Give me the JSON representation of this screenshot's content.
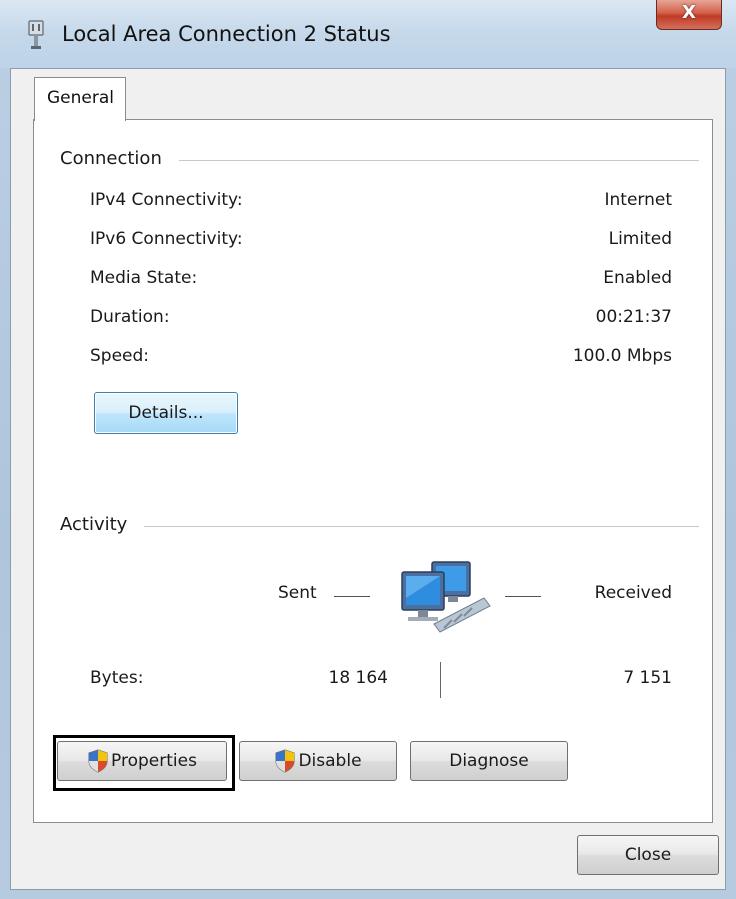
{
  "window": {
    "title": "Local Area Connection 2 Status",
    "close_glyph": "X",
    "title_icon": "network-adapter-icon"
  },
  "tabs": [
    {
      "label": "General"
    }
  ],
  "connection": {
    "heading": "Connection",
    "rows": [
      {
        "label": "IPv4 Connectivity:",
        "value": "Internet"
      },
      {
        "label": "IPv6 Connectivity:",
        "value": "Limited"
      },
      {
        "label": "Media State:",
        "value": "Enabled"
      },
      {
        "label": "Duration:",
        "value": "00:21:37"
      },
      {
        "label": "Speed:",
        "value": "100.0 Mbps"
      }
    ],
    "details_button": "Details..."
  },
  "activity": {
    "heading": "Activity",
    "sent_label": "Sent",
    "received_label": "Received",
    "bytes_label": "Bytes:",
    "bytes_sent": "18 164",
    "bytes_received": "7 151",
    "icon": "network-computers-icon"
  },
  "buttons": {
    "properties": "Properties",
    "disable": "Disable",
    "diagnose": "Diagnose",
    "close": "Close",
    "shield_icon": "uac-shield-icon"
  },
  "colors": {
    "close_button": "#c8462f",
    "details_button_border": "#3c7fb1",
    "focus_box": "#000000"
  }
}
